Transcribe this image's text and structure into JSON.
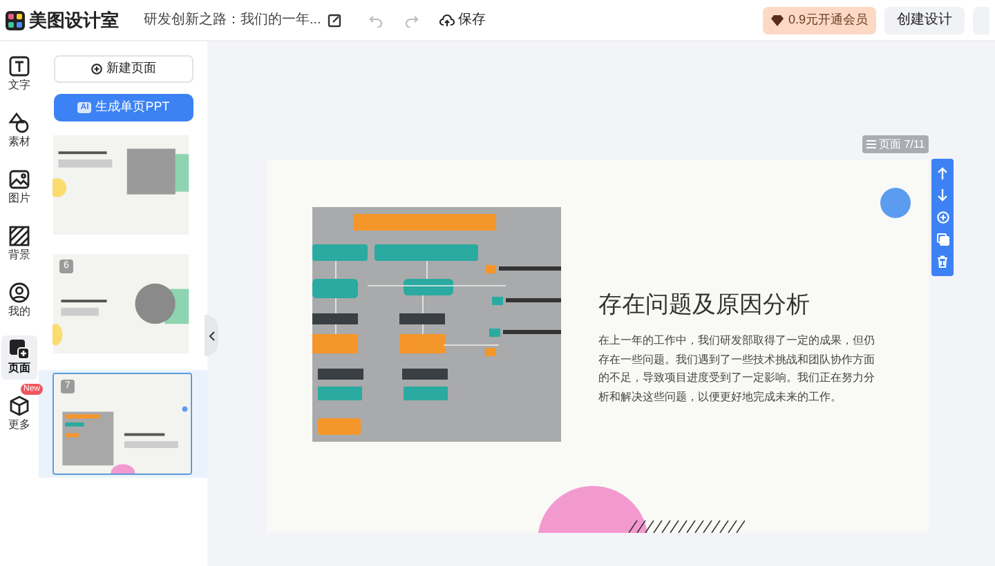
{
  "header": {
    "app_name": "美图设计室",
    "doc_title": "研发创新之路：我们的一年...",
    "save_label": "保存",
    "vip_label": "0.9元开通会员",
    "create_label": "创建设计"
  },
  "rail": [
    {
      "kind": "text",
      "label": "文字",
      "selected": false
    },
    {
      "kind": "material",
      "label": "素材",
      "selected": false
    },
    {
      "kind": "image",
      "label": "图片",
      "selected": false
    },
    {
      "kind": "background",
      "label": "背景",
      "selected": false
    },
    {
      "kind": "mine",
      "label": "我的",
      "selected": false
    },
    {
      "kind": "pages",
      "label": "页面",
      "selected": true
    },
    {
      "kind": "more",
      "label": "更多",
      "selected": false,
      "badge": "New"
    }
  ],
  "panel": {
    "new_page": "新建页面",
    "ai_button": {
      "tag": "AI",
      "label": "生成单页PPT"
    },
    "thumbnails": [
      {
        "kind": "photo",
        "selected": false
      },
      {
        "kind": "round",
        "number": "6",
        "selected": false
      },
      {
        "kind": "chart",
        "number": "7",
        "selected": true
      }
    ]
  },
  "canvas": {
    "page_indicator": "页面 7/11",
    "slide": {
      "title": "存在问题及原因分析",
      "body": "在上一年的工作中，我们研发部取得了一定的成果，但仍存在一些问题。我们遇到了一些技术挑战和团队协作方面的不足，导致项目进度受到了一定影响。我们正在努力分析和解决这些问题，以便更好地完成未来的工作。"
    }
  }
}
